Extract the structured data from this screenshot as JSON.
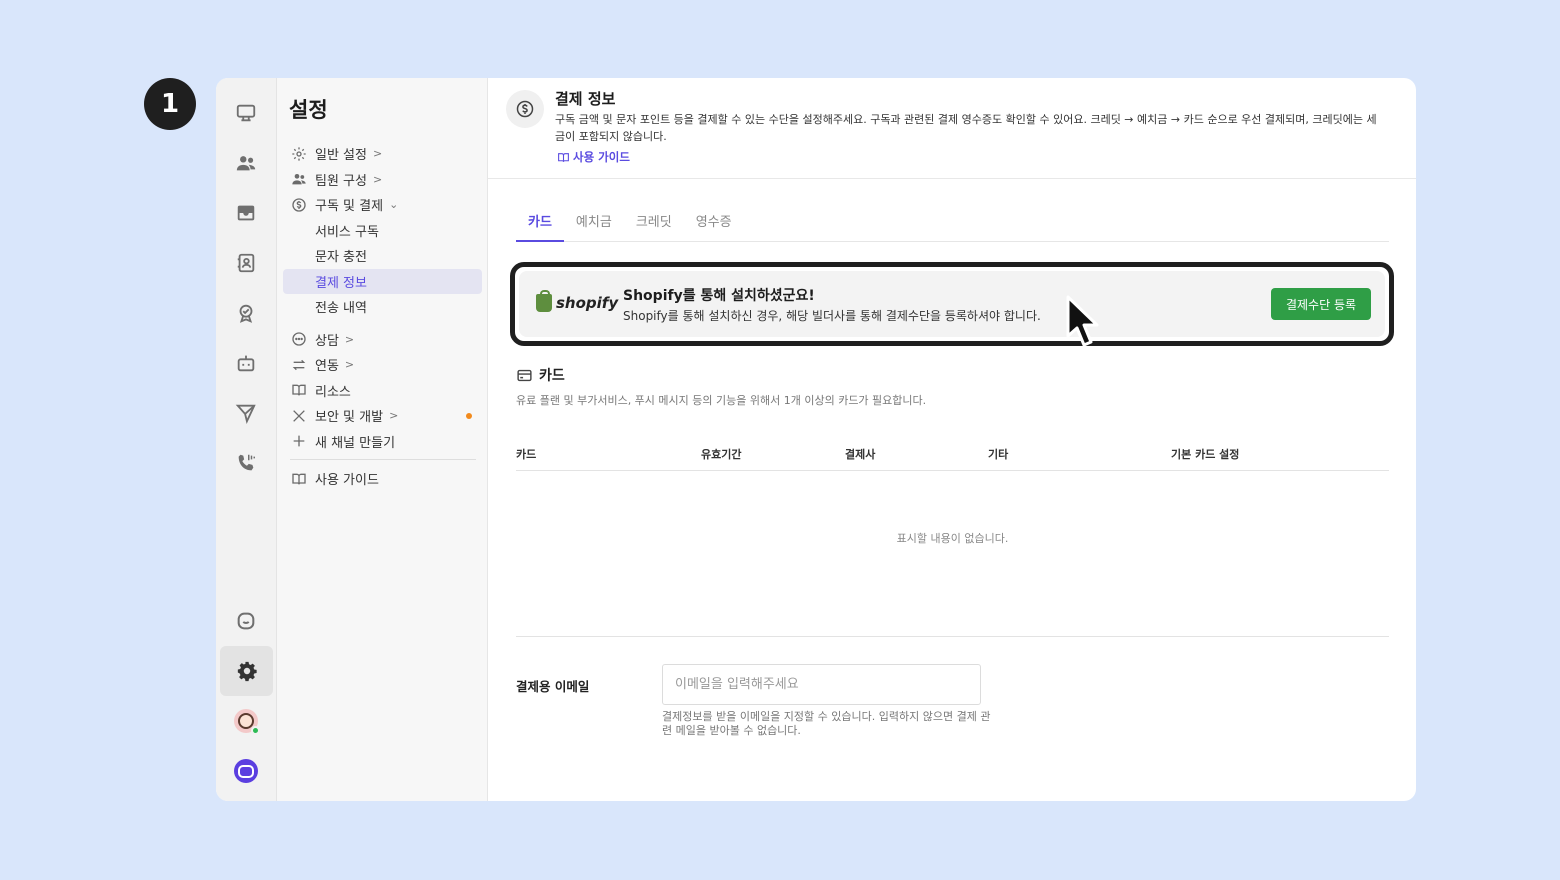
{
  "step_number": "1",
  "sidebar": {
    "title": "설정",
    "items": [
      {
        "label": "일반 설정",
        "icon": "gear-icon"
      },
      {
        "label": "팀원 구성",
        "icon": "people-icon"
      },
      {
        "label": "구독 및 결제",
        "icon": "dollar-circle-icon"
      },
      {
        "label": "상담",
        "icon": "chat-bubble-icon"
      },
      {
        "label": "연동",
        "icon": "arrows-exchange-icon"
      },
      {
        "label": "리소스",
        "icon": "book-icon"
      },
      {
        "label": "보안 및 개발",
        "icon": "tools-icon"
      },
      {
        "label": "새 채널 만들기",
        "icon": "plus-icon"
      },
      {
        "label": "사용 가이드",
        "icon": "book-icon"
      }
    ],
    "sub_items": [
      "서비스 구독",
      "문자 충전",
      "결제 정보",
      "전송 내역"
    ],
    "active_sub": "결제 정보",
    "alert_dot_color": "#f28a1c"
  },
  "header": {
    "title": "결제 정보",
    "description": "구독 금액 및 문자 포인트 등을 결제할 수 있는 수단을 설정해주세요. 구독과 관련된 결제 영수증도 확인할 수 있어요. 크레딧 → 예치금 → 카드 순으로 우선 결제되며, 크레딧에는 세금이 포함되지 않습니다.",
    "guide_link": "사용 가이드"
  },
  "tabs": [
    "카드",
    "예치금",
    "크레딧",
    "영수증"
  ],
  "active_tab": "카드",
  "notice": {
    "logo_text": "shopify",
    "title": "Shopify를 통해 설치하셨군요!",
    "description": "Shopify를 통해 설치하신 경우, 해당 빌더사를 통해 결제수단을 등록하셔야 합니다.",
    "button": "결제수단 등록",
    "button_color": "#2f9e46"
  },
  "card_section": {
    "title": "카드",
    "description": "유료 플랜 및 부가서비스, 푸시 메시지 등의 기능을 위해서 1개 이상의 카드가 필요합니다.",
    "columns": [
      "카드",
      "유효기간",
      "결제사",
      "기타",
      "기본 카드 설정"
    ],
    "empty_text": "표시할 내용이 없습니다."
  },
  "email": {
    "label": "결제용 이메일",
    "placeholder": "이메일을 입력해주세요",
    "value": "",
    "help": "결제정보를 받을 이메일을 지정할 수 있습니다. 입력하지 않으면 결제 관련 메일을 받아볼 수 없습니다."
  },
  "accent_color": "#5a4be0"
}
